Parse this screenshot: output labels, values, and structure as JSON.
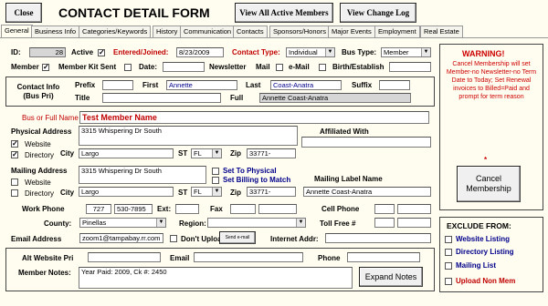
{
  "header": {
    "close_label": "Close",
    "title": "CONTACT DETAIL FORM",
    "view_members_label": "View All Active Members",
    "view_changelog_label": "View Change Log"
  },
  "tabs": [
    "General",
    "Business Info",
    "Categories/Keywords",
    "History",
    "Communication",
    "Contacts",
    "Sponsors/Honors",
    "Major Events",
    "Employment",
    "Real Estate"
  ],
  "row1": {
    "id_label": "ID:",
    "id_value": "28",
    "active_label": "Active",
    "active_checked": true,
    "entered_label": "Entered/Joined:",
    "entered_value": "8/23/2009",
    "contact_type_label": "Contact Type:",
    "contact_type_value": "Individual",
    "bus_type_label": "Bus Type:",
    "bus_type_value": "Member"
  },
  "row2": {
    "member_label": "Member",
    "member_checked": true,
    "kit_label": "Member Kit Sent",
    "date_label": "Date:",
    "newsletter_label": "Newsletter",
    "mail_label": "Mail",
    "email_label": "e-Mail",
    "birth_label": "Birth/Establish"
  },
  "contact_info": {
    "section_label": "Contact Info (Bus Pri)",
    "prefix_label": "Prefix",
    "first_label": "First",
    "first_value": "Annette",
    "last_label": "Last",
    "last_value": "Coast-Anatra",
    "suffix_label": "Suffix",
    "title_label": "Title",
    "full_label": "Full",
    "full_value": "Annette Coast-Anatra"
  },
  "bus_name": {
    "label": "Bus or Full Name",
    "value": "Test Member Name"
  },
  "physical": {
    "label": "Physical Address",
    "street": "3315 Whispering Dr South",
    "website_label": "Website",
    "website_checked": true,
    "directory_label": "Directory",
    "directory_checked": true,
    "city_label": "City",
    "city": "Largo",
    "st_label": "ST",
    "st": "FL",
    "zip_label": "Zip",
    "zip": "33771-",
    "affiliated_label": "Affiliated With"
  },
  "mailing": {
    "label": "Mailing Address",
    "street": "3315 Whispering Dr South",
    "website_label": "Website",
    "directory_label": "Directory",
    "set_physical": "Set To Physical",
    "set_billing": "Set Billing to Match",
    "city_label": "City",
    "city": "Largo",
    "st_label": "ST",
    "st": "FL",
    "zip_label": "Zip",
    "zip": "33771-",
    "mailing_label_title": "Mailing Label Name",
    "mailing_label_value": "Annette Coast-Anatra"
  },
  "phones": {
    "work_label": "Work Phone",
    "work_area": "727",
    "work_number": "530-7895",
    "ext_label": "Ext:",
    "fax_label": "Fax",
    "cell_label": "Cell Phone",
    "county_label": "County:",
    "county_value": "Pinellas",
    "region_label": "Region:",
    "tollfree_label": "Toll Free #"
  },
  "email": {
    "label": "Email Address",
    "value": "zoom1@tampabay.rr.com",
    "dont_upload_label": "Don't Upload",
    "send_label": "Send e-mail",
    "internet_label": "Internet Addr:"
  },
  "alt": {
    "website_label": "Alt Website Pri",
    "email_label": "Email",
    "phone_label": "Phone"
  },
  "notes": {
    "label": "Member Notes:",
    "value": "Year Paid: 2009, Ck #: 2450",
    "expand_label": "Expand Notes"
  },
  "warning": {
    "title": "WARNING!",
    "text": "Cancel Membership will set Member-no Newsletter-no Term Date to Today; Set Renewal invoices to Billed=Paid and prompt for term reason",
    "star": "*",
    "cancel_label": "Cancel Membership"
  },
  "exclude": {
    "title": "EXCLUDE FROM:",
    "items": [
      "Website Listing",
      "Directory Listing",
      "Mailing List"
    ],
    "upload_label": "Upload Non Mem"
  },
  "colors": {
    "background": "#fffdf0",
    "red": "#c00000",
    "navy": "#00008b",
    "warning": "#cc0000"
  }
}
